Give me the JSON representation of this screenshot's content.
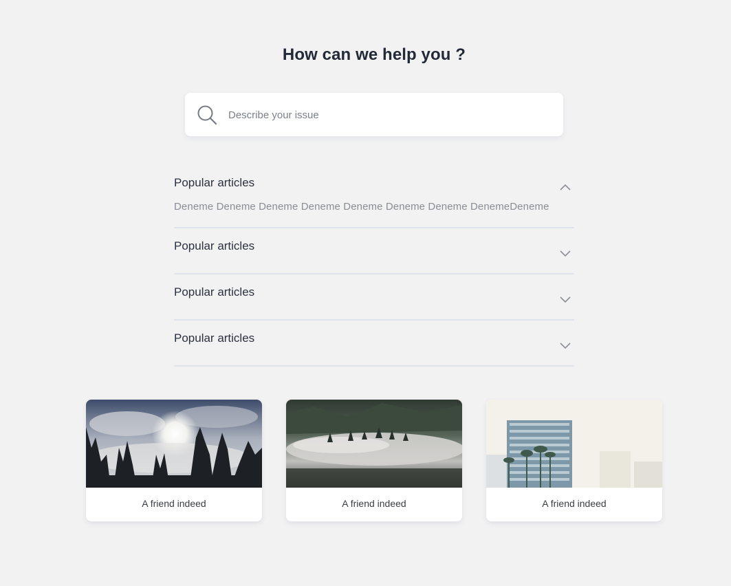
{
  "header": {
    "title": "How can we help you ?"
  },
  "search": {
    "placeholder": "Describe your issue",
    "value": "",
    "icon": "search-icon"
  },
  "accordion": {
    "items": [
      {
        "title": "Popular articles",
        "expanded": true,
        "body": "Deneme Deneme Deneme Deneme Deneme Deneme Deneme DenemeDeneme"
      },
      {
        "title": "Popular articles",
        "expanded": false
      },
      {
        "title": "Popular articles",
        "expanded": false
      },
      {
        "title": "Popular articles",
        "expanded": false
      }
    ],
    "chevron_color": "#8c8f97",
    "divider_color": "#dfe3ed"
  },
  "cards": [
    {
      "label": "A friend indeed",
      "image": "forest-trees-sun-mist-photo"
    },
    {
      "label": "A friend indeed",
      "image": "foggy-mountain-forest-photo"
    },
    {
      "label": "A friend indeed",
      "image": "city-building-palm-trees-photo"
    }
  ],
  "colors": {
    "background": "#f2f2f2",
    "title": "#242938",
    "text": "#2c3140",
    "muted": "#8a8d96"
  }
}
